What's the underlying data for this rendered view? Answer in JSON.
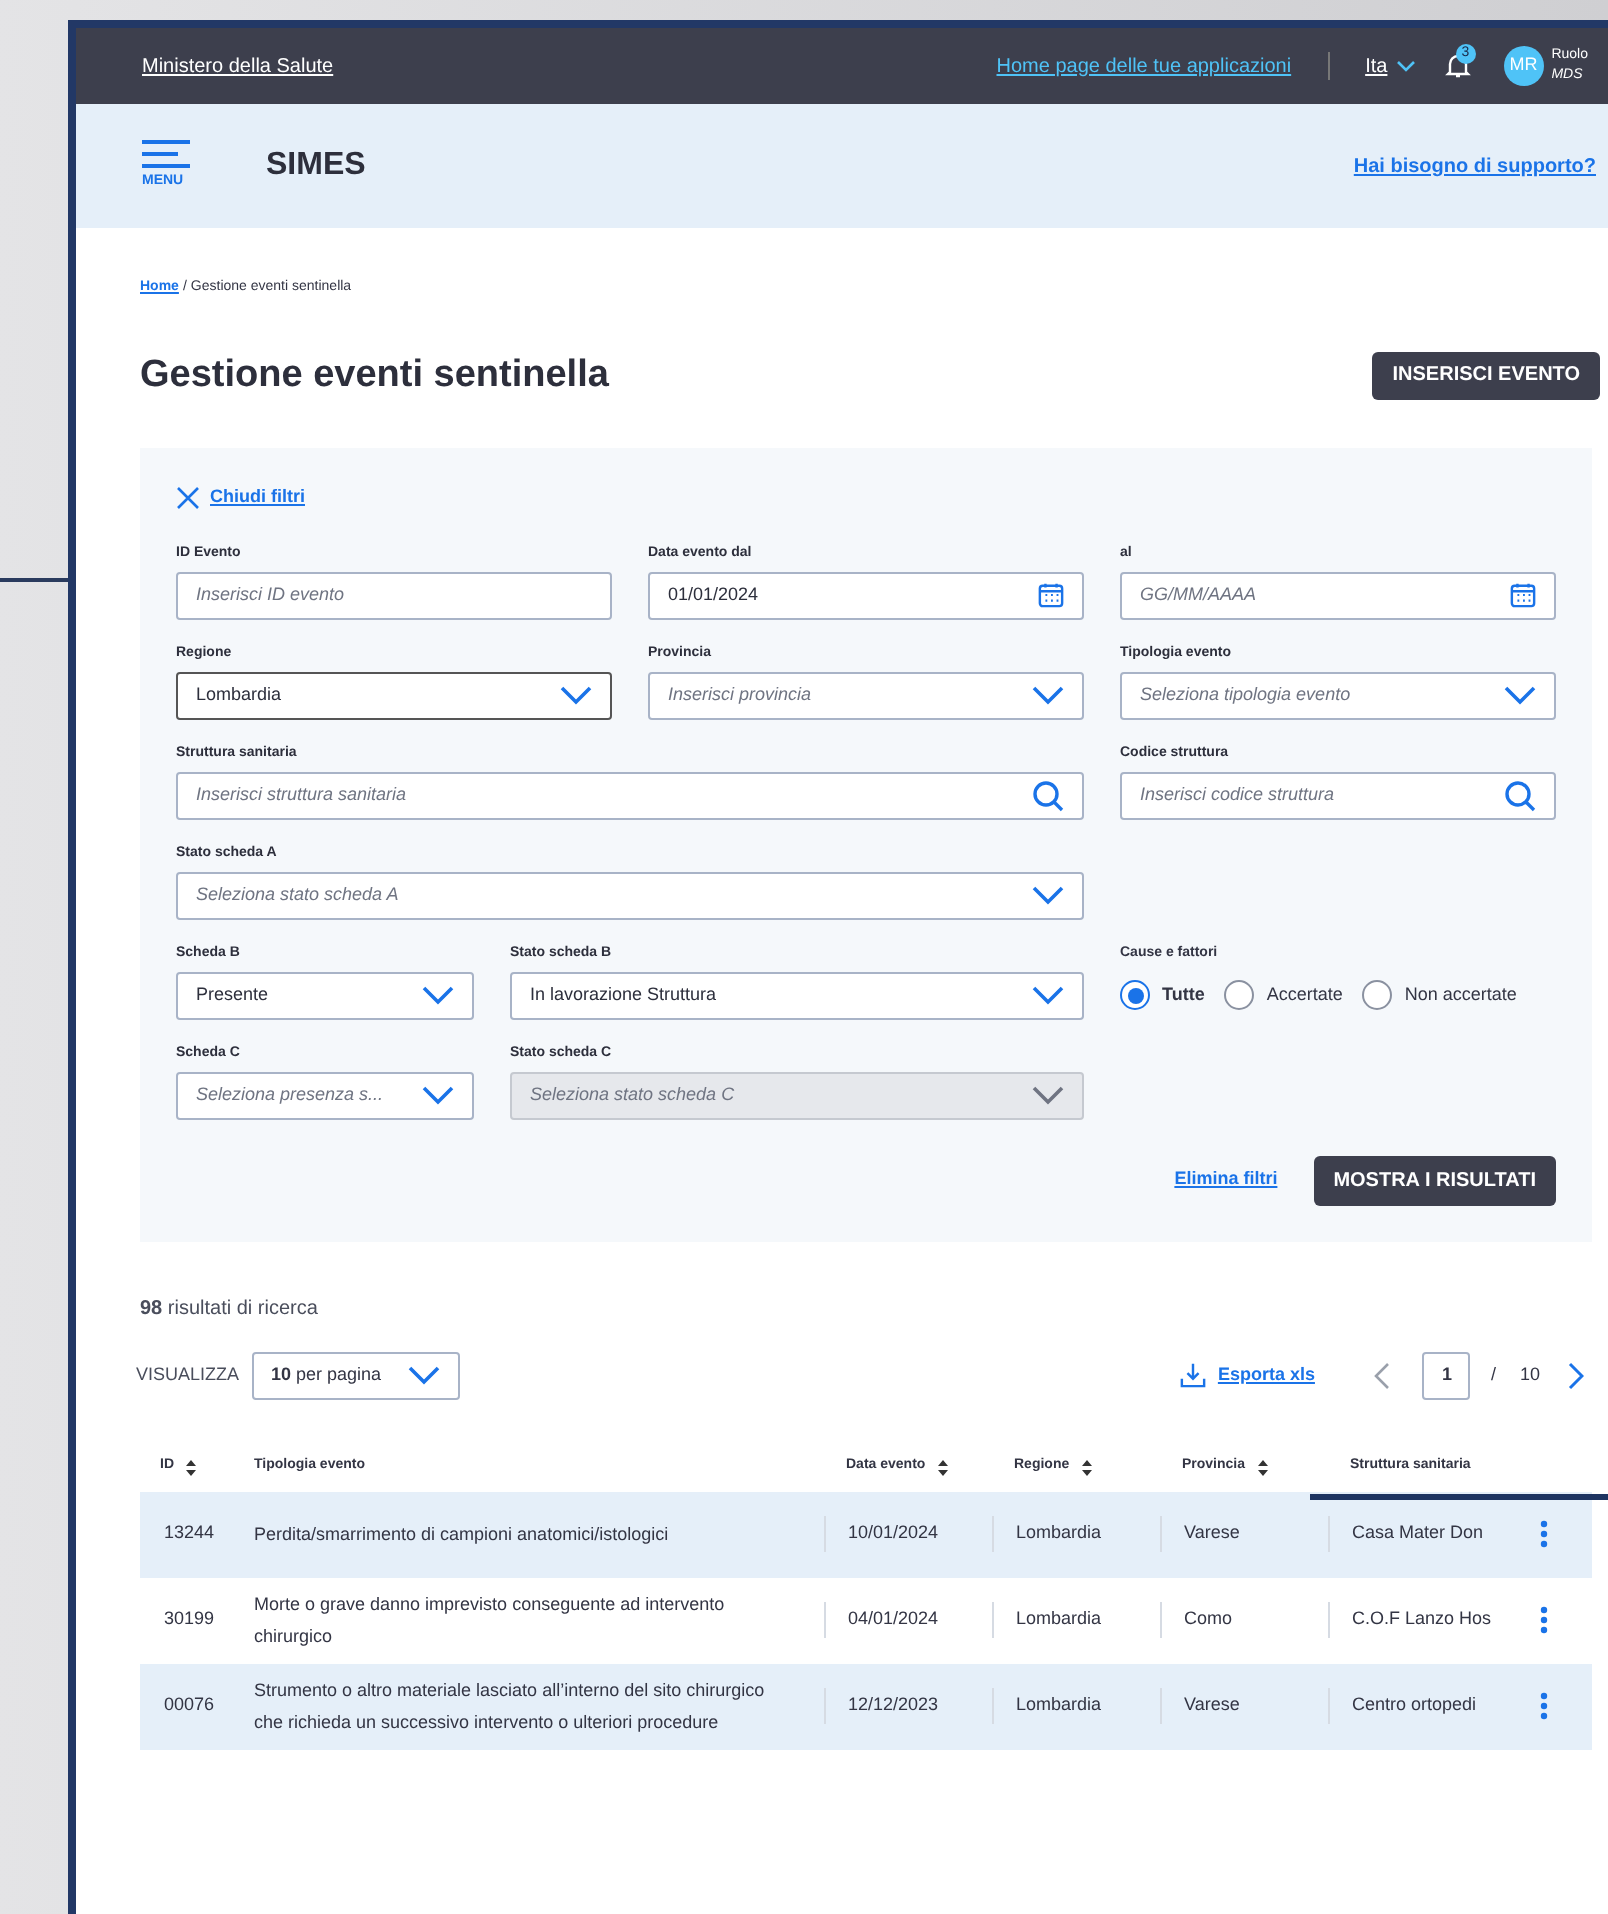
{
  "top_bar": {
    "brand": "Ministero della Salute",
    "apps_link": "Home page delle tue applicazioni",
    "language": "Ita",
    "notifications": "3",
    "avatar": "MR",
    "role": "Ruolo",
    "role_value": "MDS"
  },
  "header": {
    "menu_label": "MENU",
    "app_name": "SIMES",
    "support_link": "Hai bisogno di supporto?"
  },
  "breadcrumb": {
    "home": "Home",
    "separator": "/",
    "current": "Gestione eventi sentinella"
  },
  "title": "Gestione eventi sentinella",
  "insert_button": "INSERISCI EVENTO",
  "filters": {
    "close_label": "Chiudi filtri",
    "fields": [
      {
        "label": "ID Evento",
        "kind": "text",
        "placeholder": "Inserisci ID evento",
        "focused": false
      },
      {
        "label": "Data evento dal",
        "kind": "date",
        "value": "01/01/2024",
        "focused": false
      },
      {
        "label": "al",
        "kind": "date",
        "placeholder": "GG/MM/AAAA",
        "focused": false
      },
      {
        "label": "Regione",
        "kind": "select",
        "value": "Lombardia",
        "focused": true
      },
      {
        "label": "Provincia",
        "kind": "select",
        "placeholder": "Inserisci provincia",
        "focused": false
      },
      {
        "label": "Tipologia evento",
        "kind": "select",
        "placeholder": "Seleziona tipologia evento",
        "focused": false
      },
      {
        "label": "Struttura sanitaria",
        "kind": "search",
        "placeholder": "Inserisci struttura sanitaria",
        "focused": false
      },
      {
        "label": "Codice struttura",
        "kind": "search",
        "placeholder": "Inserisci codice struttura",
        "focused": false
      },
      {
        "label": "Stato scheda A",
        "kind": "select",
        "placeholder": "Seleziona stato scheda A",
        "focused": false
      }
    ],
    "scheda_b": {
      "label": "Scheda B",
      "value": "Presente"
    },
    "stato_b": {
      "label": "Stato scheda B",
      "value": "In lavorazione Struttura"
    },
    "cause": {
      "label": "Cause e fattori",
      "options": [
        {
          "label": "Tutte",
          "selected": true
        },
        {
          "label": "Accertate",
          "selected": false
        },
        {
          "label": "Non accertate",
          "selected": false
        }
      ]
    },
    "scheda_c": {
      "label": "Scheda C",
      "placeholder": "Seleziona presenza s...",
      "disabled": false
    },
    "stato_c": {
      "label": "Stato scheda C",
      "placeholder": "Seleziona stato scheda C",
      "disabled": true
    },
    "clear_link": "Elimina filtri",
    "show_button": "MOSTRA I RISULTATI"
  },
  "results": {
    "count": "98",
    "count_text": "risultati di ricerca",
    "view_label": "VISUALIZZA",
    "per_page_count": "10",
    "per_page_text": "per pagina",
    "export": "Esporta xls",
    "page": "1",
    "separator": "/",
    "pages": "10"
  },
  "table": {
    "columns": [
      {
        "label": "ID",
        "sortable": true
      },
      {
        "label": "Tipologia evento",
        "sortable": false
      },
      {
        "label": "Data evento",
        "sortable": true
      },
      {
        "label": "Regione",
        "sortable": true
      },
      {
        "label": "Provincia",
        "sortable": true
      },
      {
        "label": "Struttura sanitaria",
        "sortable": false
      }
    ],
    "rows": [
      {
        "cells": [
          "13244",
          "Perdita/smarrimento di campioni anatomici/istologici",
          "10/01/2024",
          "Lombardia",
          "Varese",
          "Casa Mater Don"
        ]
      },
      {
        "cells": [
          "30199",
          "Morte o grave danno imprevisto conseguente ad intervento chirurgico",
          "04/01/2024",
          "Lombardia",
          "Como",
          "C.O.F Lanzo Hos"
        ]
      },
      {
        "cells": [
          "00076",
          "Strumento o altro materiale lasciato all’interno del sito chirurgico che richieda un successivo intervento o ulteriori procedure",
          "12/12/2023",
          "Lombardia",
          "Varese",
          "Centro ortopedi"
        ]
      }
    ]
  }
}
